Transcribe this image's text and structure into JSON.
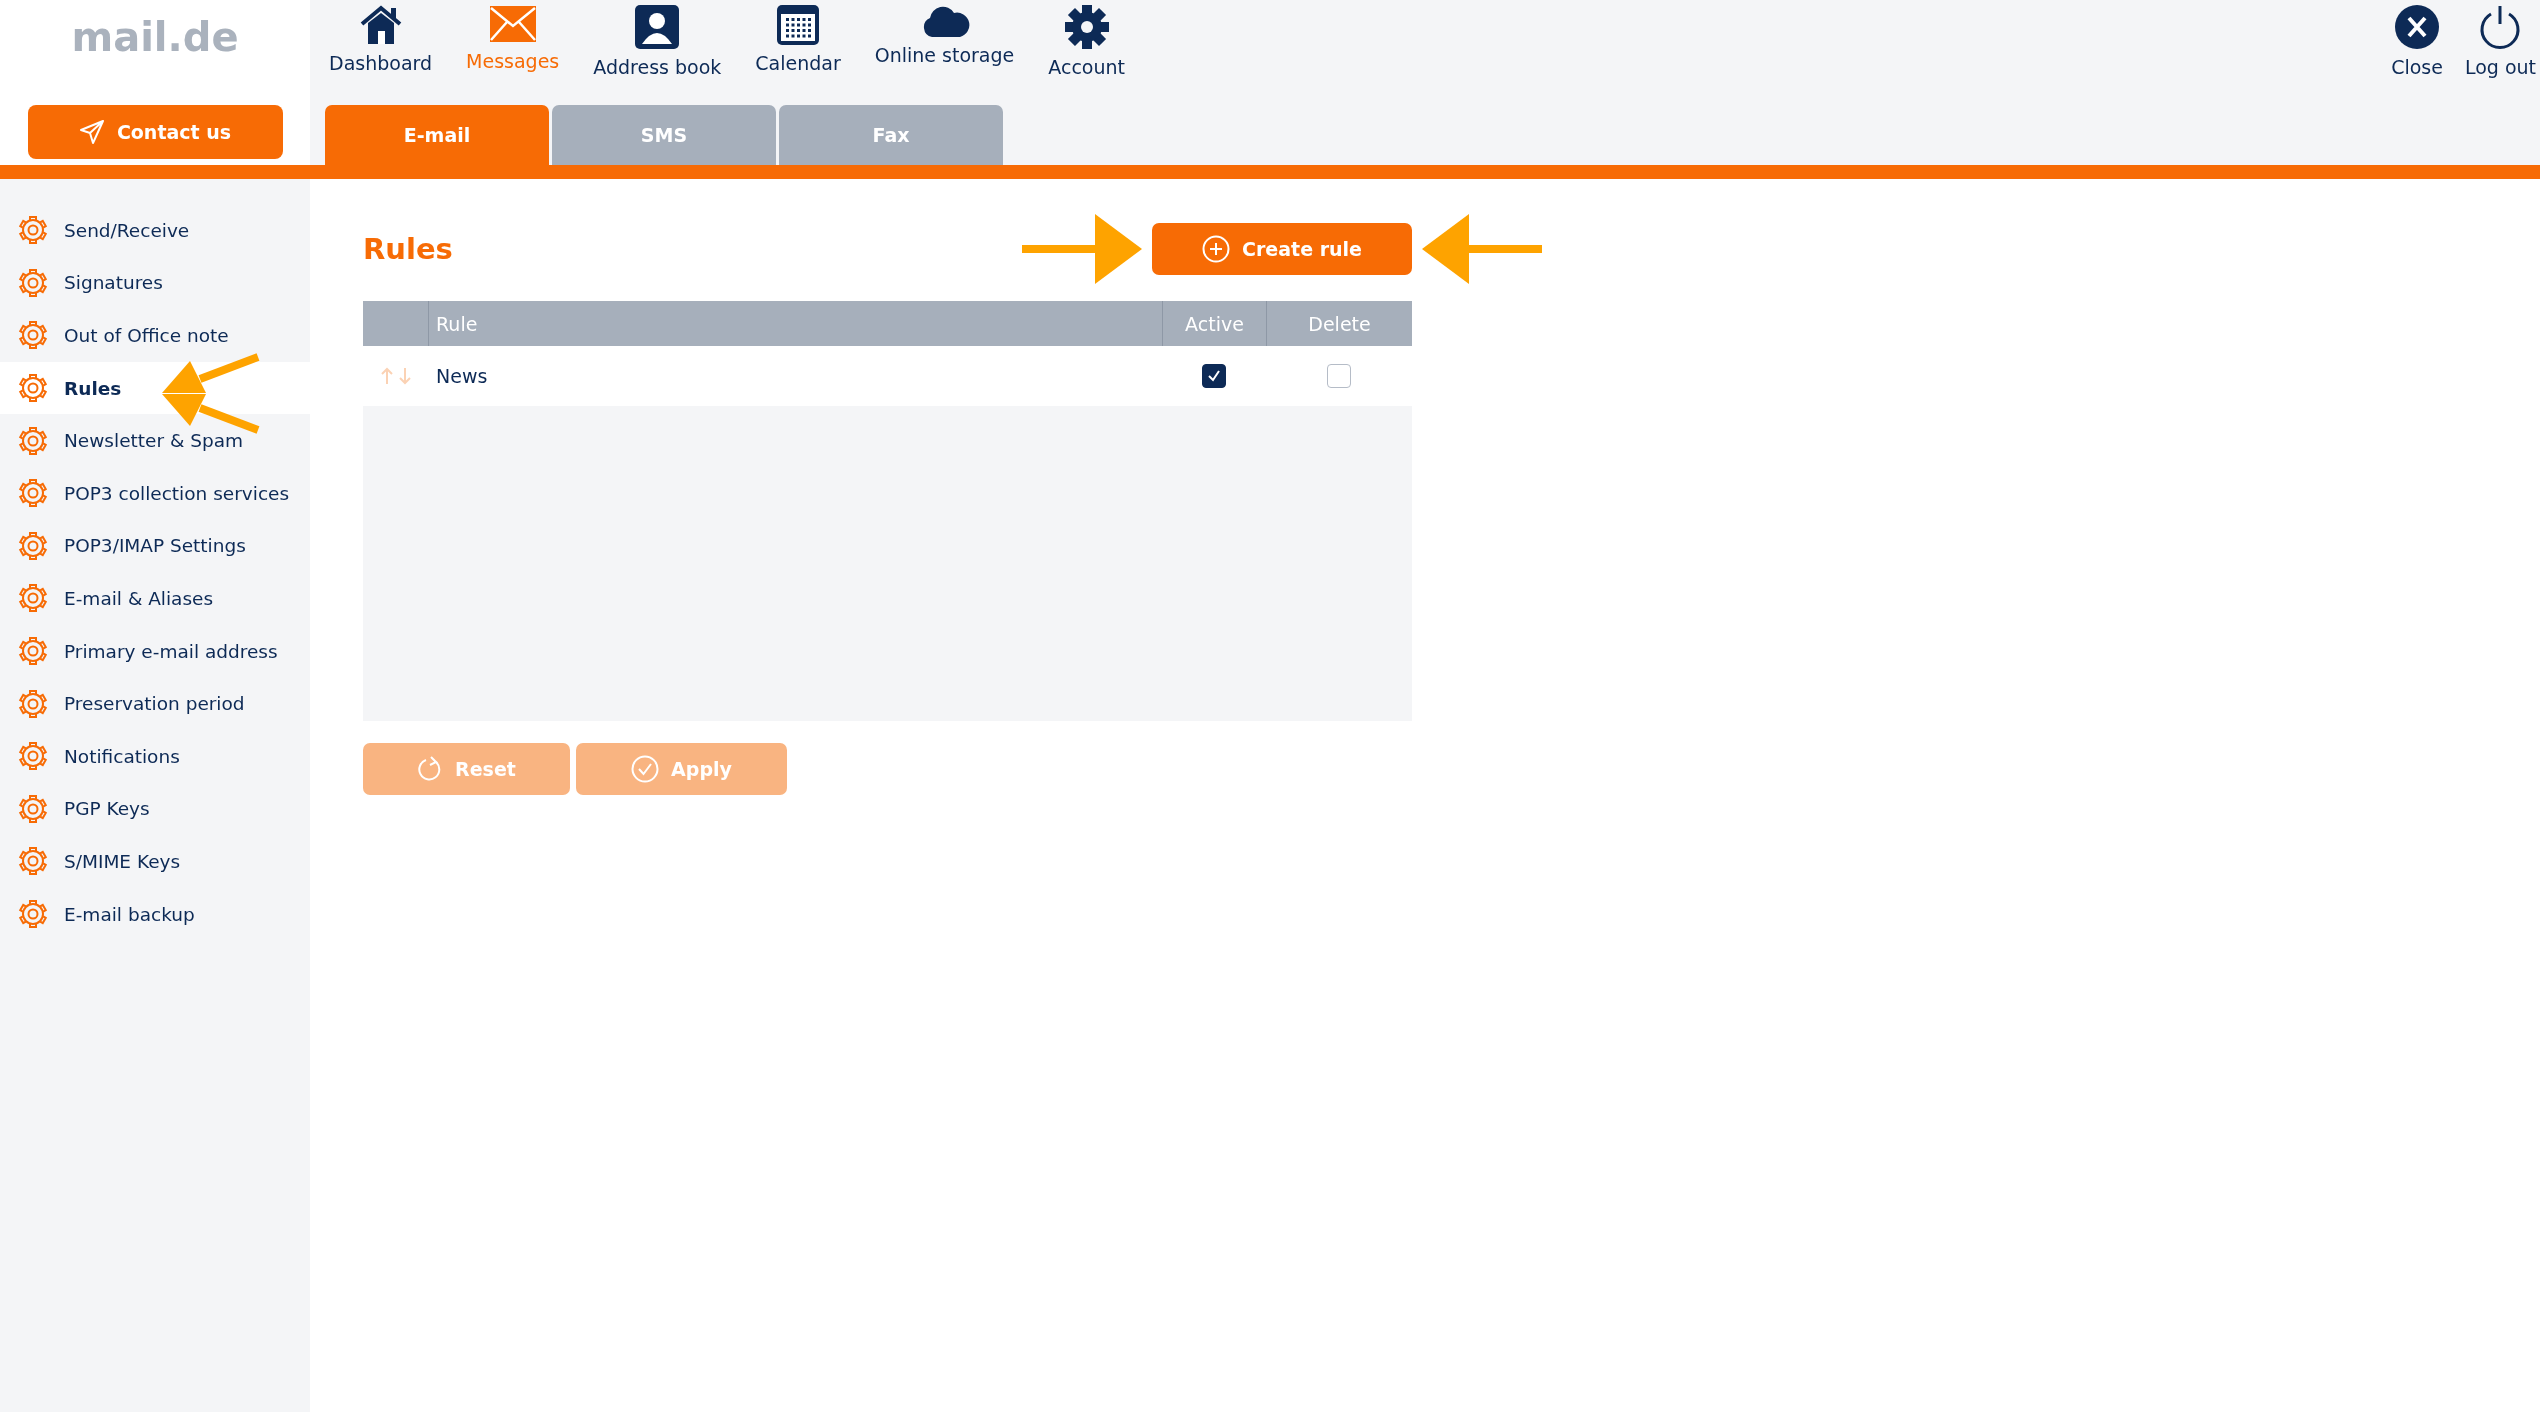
{
  "logo": {
    "text": "mail.de"
  },
  "contact_button": {
    "label": "Contact us"
  },
  "nav": [
    {
      "label": "Dashboard",
      "selected": false
    },
    {
      "label": "Messages",
      "selected": true
    },
    {
      "label": "Address book",
      "selected": false
    },
    {
      "label": "Calendar",
      "selected": false
    },
    {
      "label": "Online storage",
      "selected": false
    },
    {
      "label": "Account",
      "selected": false
    }
  ],
  "nav_right": [
    {
      "label": "Close"
    },
    {
      "label": "Log out"
    }
  ],
  "tabs": [
    {
      "label": "E-mail",
      "selected": true
    },
    {
      "label": "SMS",
      "selected": false
    },
    {
      "label": "Fax",
      "selected": false
    }
  ],
  "sidebar": {
    "items": [
      {
        "label": "Send/Receive",
        "selected": false
      },
      {
        "label": "Signatures",
        "selected": false
      },
      {
        "label": "Out of Office note",
        "selected": false
      },
      {
        "label": "Rules",
        "selected": true
      },
      {
        "label": "Newsletter & Spam",
        "selected": false
      },
      {
        "label": "POP3 collection services",
        "selected": false
      },
      {
        "label": "POP3/IMAP Settings",
        "selected": false
      },
      {
        "label": "E-mail & Aliases",
        "selected": false
      },
      {
        "label": "Primary e-mail address",
        "selected": false
      },
      {
        "label": "Preservation period",
        "selected": false
      },
      {
        "label": "Notifications",
        "selected": false
      },
      {
        "label": "PGP Keys",
        "selected": false
      },
      {
        "label": "S/MIME Keys",
        "selected": false
      },
      {
        "label": "E-mail backup",
        "selected": false
      }
    ]
  },
  "page_title": "Rules",
  "create_button": {
    "label": "Create rule"
  },
  "table": {
    "columns": [
      "Rule",
      "Active",
      "Delete"
    ],
    "rows": [
      {
        "rule": "News",
        "active": true,
        "delete": false
      }
    ]
  },
  "actions": [
    {
      "label": "Reset",
      "disabled": true
    },
    {
      "label": "Apply",
      "disabled": true
    }
  ]
}
